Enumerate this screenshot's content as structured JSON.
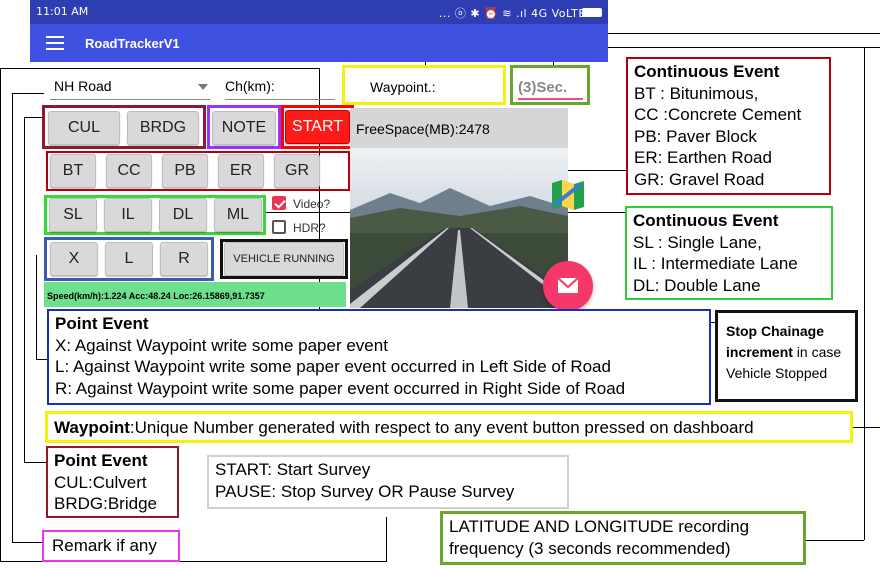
{
  "status_bar": {
    "time": "11:01 AM",
    "icons_text": "... ⓞ ✱ ⏰ ≋ .ıl 4G VoLTE ⚡",
    "battery_icon": "battery-icon"
  },
  "app_bar": {
    "title": "RoadTrackerV1",
    "menu_icon": "hamburger-icon"
  },
  "form": {
    "road_type_selected": "NH Road",
    "chainage_label": "Ch(km):",
    "waypoint_label": "Waypoint.:",
    "interval_value": "(3)Sec."
  },
  "buttons": {
    "point_top": [
      "CUL",
      "BRDG"
    ],
    "note": "NOTE",
    "start": "START",
    "surface": [
      "BT",
      "CC",
      "PB",
      "ER",
      "GR"
    ],
    "lanes": [
      "SL",
      "IL",
      "DL",
      "ML"
    ],
    "side": [
      "X",
      "L",
      "R"
    ],
    "vehicle": "VEHICLE RUNNING"
  },
  "freespace": "FreeSpace(MB):2478",
  "checkboxes": {
    "video": "Video?",
    "hdr": "HDR?"
  },
  "speed_line": "Speed(km/h):1.224 Acc:48.24 Loc:26.15869,91.7357",
  "annotations": {
    "continuous_surface": {
      "title": "Continuous Event",
      "lines": [
        "BT : Bitunimous,",
        "CC :Concrete Cement",
        "PB: Paver Block",
        "ER: Earthen Road",
        "GR: Gravel Road"
      ]
    },
    "continuous_lane": {
      "title": "Continuous Event",
      "lines": [
        "SL : Single Lane,",
        "IL  : Intermediate Lane",
        "DL: Double Lane"
      ]
    },
    "point_side": {
      "title": "Point Event",
      "lines": [
        "X:  Against Waypoint write some paper event",
        "L:  Against Waypoint write some paper event occurred in Left Side of Road",
        "R: Against Waypoint write some paper event occurred in Right Side of Road"
      ]
    },
    "stop_chainage": {
      "bold": "Stop Chainage increment",
      "rest": " in case Vehicle Stopped"
    },
    "waypoint": {
      "bold": "Waypoint",
      "rest": ":Unique Number generated with respect to any event button pressed on dashboard"
    },
    "point_structures": {
      "title": "Point Event",
      "lines": [
        "CUL:Culvert",
        "BRDG:Bridge"
      ]
    },
    "start_pause": {
      "lines": [
        "START: Start Survey",
        "PAUSE: Stop Survey OR Pause Survey"
      ]
    },
    "latlong": {
      "lines": [
        "LATITUDE AND LONGITUDE recording",
        "frequency (3 seconds recommended)"
      ]
    },
    "remark": "Remark if any"
  },
  "colors": {
    "app_bar": "#3f51e0",
    "status_bar": "#2f3db3",
    "start_button": "#ff1a1a",
    "speed_bar": "#6ee08c",
    "fab": "#f5386a"
  }
}
